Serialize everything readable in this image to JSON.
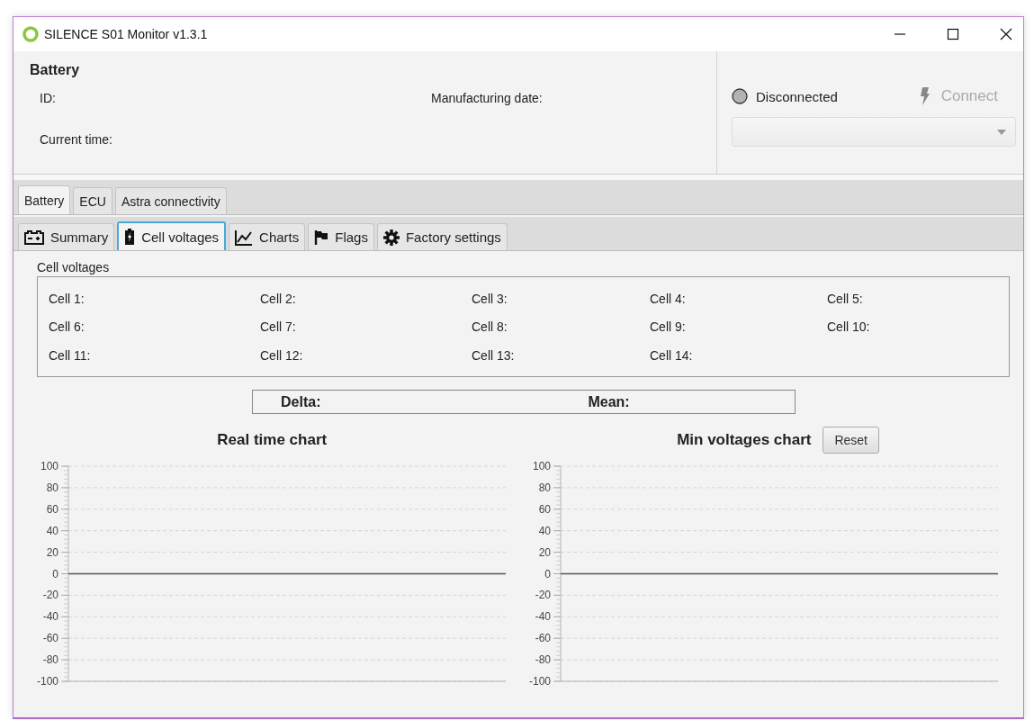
{
  "window": {
    "title": "SILENCE S01 Monitor v1.3.1"
  },
  "battery_info": {
    "heading": "Battery",
    "fields": [
      {
        "label": "ID:"
      },
      {
        "label": "Manufacturing date:"
      },
      {
        "label": "Current time:"
      }
    ]
  },
  "connection": {
    "status": "Disconnected",
    "connected": false,
    "connect_button": {
      "label": "Connect",
      "disabled": true
    },
    "port_select": {
      "disabled": true
    }
  },
  "tabs": [
    {
      "label": "Battery",
      "selected": true
    },
    {
      "label": "ECU",
      "selected": false
    },
    {
      "label": "Astra connectivity",
      "selected": false
    }
  ],
  "subtabs": [
    {
      "label": "Summary",
      "selected": false
    },
    {
      "label": "Cell voltages",
      "selected": true
    },
    {
      "label": "Charts",
      "selected": false
    },
    {
      "label": "Flags",
      "selected": false
    },
    {
      "label": "Factory settings",
      "selected": false
    }
  ],
  "cell_voltages": {
    "title": "Cell voltages",
    "cells": [
      "Cell 1:",
      "Cell 2:",
      "Cell 3:",
      "Cell 4:",
      "Cell 5:",
      "Cell 6:",
      "Cell 7:",
      "Cell 8:",
      "Cell 9:",
      "Cell 10:",
      "Cell 11:",
      "Cell 12:",
      "Cell 13:",
      "Cell 14:"
    ]
  },
  "summary": {
    "delta": "Delta:",
    "mean": "Mean:"
  },
  "charts": [
    {
      "title": "Real time chart",
      "y_axis_labels": [
        "100",
        "80",
        "60",
        "40",
        "20",
        "0",
        "-20",
        "-40",
        "-60",
        "-80",
        "-100"
      ]
    },
    {
      "title": "Min voltages chart",
      "reset_button": "Reset",
      "y_axis_labels": [
        "100",
        "80",
        "60",
        "40",
        "20",
        "0",
        "-20",
        "-40",
        "-60",
        "-80",
        "-100"
      ]
    }
  ]
}
